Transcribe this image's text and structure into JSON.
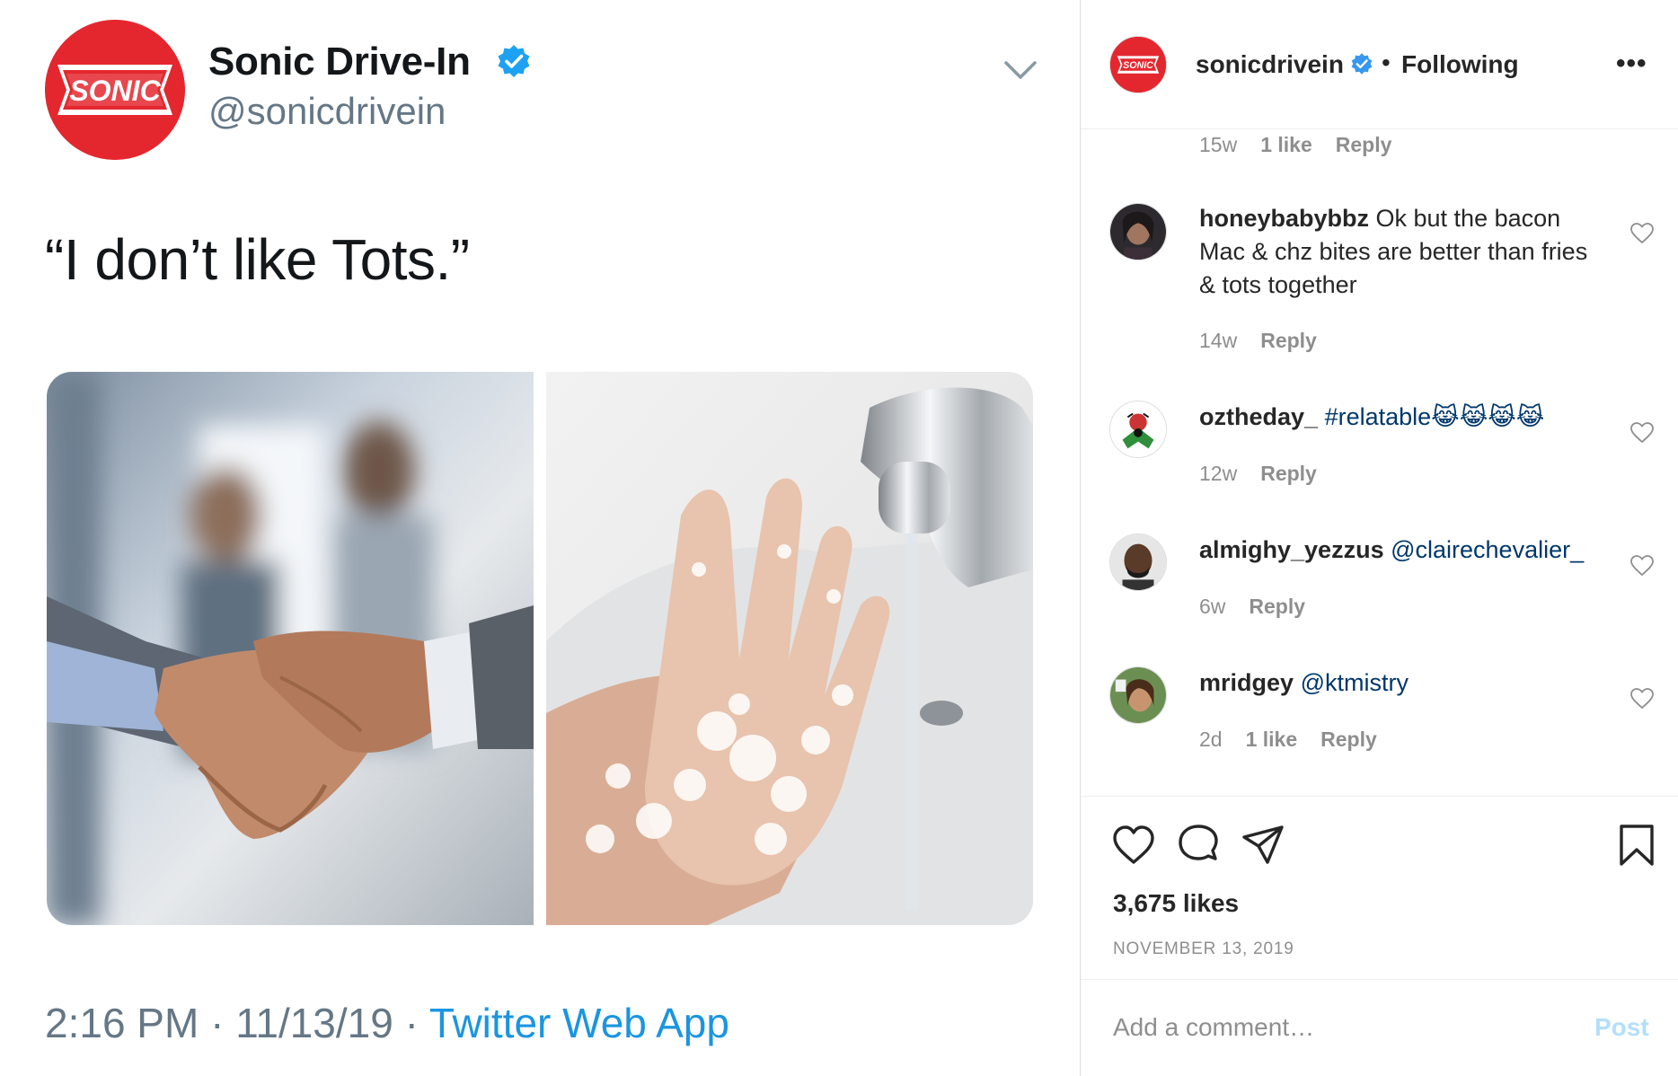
{
  "tweet": {
    "display_name": "Sonic Drive-In",
    "handle": "@sonicdrivein",
    "text": "“I don’t like Tots.”",
    "time": "2:16 PM · 11/13/19 · ",
    "source": "Twitter Web App",
    "logo_text": "SONIC",
    "images": [
      "handshake-photo",
      "handwashing-photo"
    ],
    "icons": {
      "verified": "verified-badge-icon",
      "menu": "chevron-down-icon"
    },
    "colors": {
      "brand_red": "#e4272e",
      "link_blue": "#1b95e0",
      "verified_blue": "#1da1f2"
    }
  },
  "instagram": {
    "header": {
      "username": "sonicdrivein",
      "separator": "•",
      "follow_status": "Following",
      "more": "•••"
    },
    "top_meta": {
      "time": "15w",
      "likes": "1 like",
      "reply": "Reply"
    },
    "comments": [
      {
        "user": "honeybabybbz",
        "text": " Ok but the bacon Mac & chz bites are better than fries & tots together",
        "tag": "",
        "time": "14w",
        "likes": "",
        "reply": "Reply"
      },
      {
        "user": "oztheday_",
        "text": " ",
        "tag": "#relatable😹😹😹😹",
        "time": "12w",
        "likes": "",
        "reply": "Reply"
      },
      {
        "user": "almighy_yezzus",
        "text": " ",
        "tag": "@clairechevalier_",
        "time": "6w",
        "likes": "",
        "reply": "Reply"
      },
      {
        "user": "mridgey",
        "text": " ",
        "tag": "@ktmistry",
        "time": "2d",
        "likes": "1 like",
        "reply": "Reply"
      }
    ],
    "likes": "3,675 likes",
    "date": "NOVEMBER 13, 2019",
    "add_comment_placeholder": "Add a comment…",
    "post_label": "Post",
    "colors": {
      "link": "#00376b",
      "post_disabled": "#b2dffc",
      "verified": "#3897f0"
    }
  }
}
